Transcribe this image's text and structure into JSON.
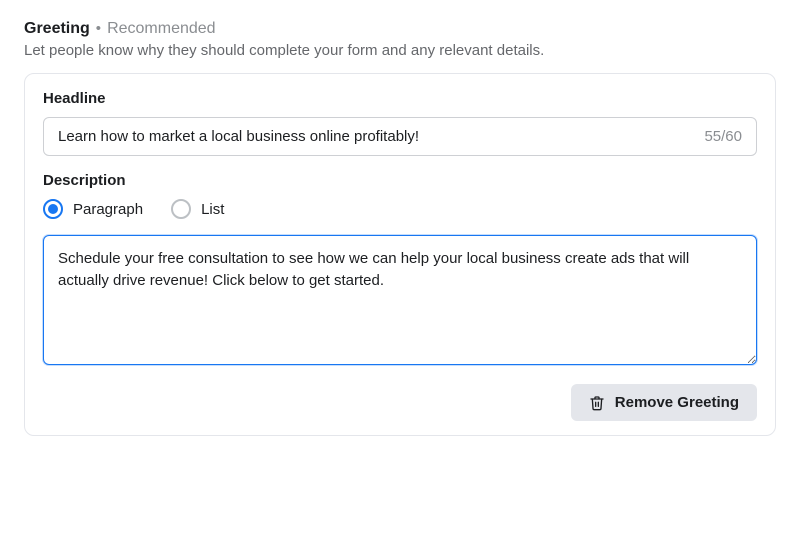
{
  "header": {
    "title": "Greeting",
    "badge": "Recommended",
    "description": "Let people know why they should complete your form and any relevant details."
  },
  "headline": {
    "label": "Headline",
    "value": "Learn how to market a local business online profitably!",
    "char_count": "55/60"
  },
  "description": {
    "label": "Description",
    "options": {
      "paragraph": "Paragraph",
      "list": "List"
    },
    "selected": "paragraph",
    "value": "Schedule your free consultation to see how we can help your local business create ads that will actually drive revenue! Click below to get started."
  },
  "footer": {
    "remove_label": "Remove Greeting"
  }
}
